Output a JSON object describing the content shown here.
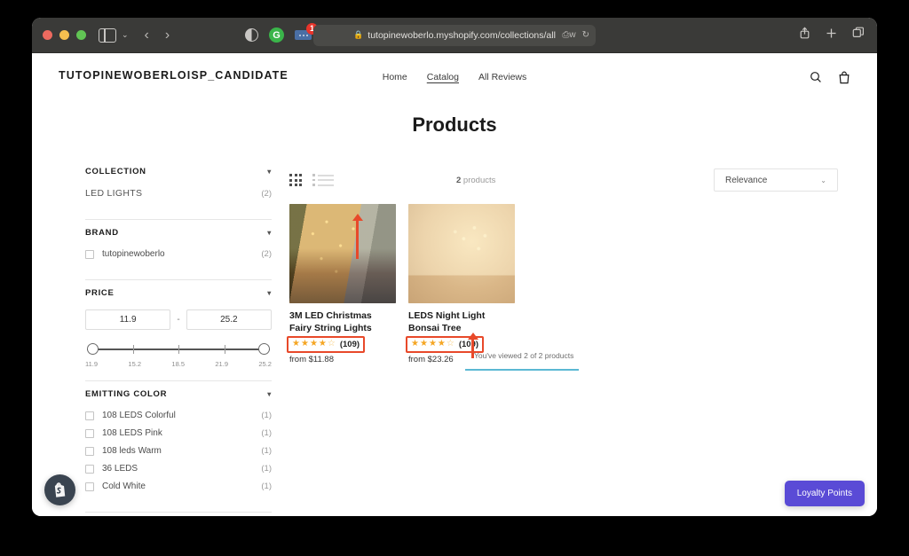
{
  "browser": {
    "url": "tutopinewoberlo.myshopify.com/collections/all",
    "lock_icon": "lock-icon",
    "back_icon": "‹",
    "forward_icon": "›",
    "sidebar_icon": "sidebar-toggle-icon",
    "chevron_icon": "⌄",
    "extension_badge_count": "1",
    "share_icon": "share-icon",
    "new_tab_icon": "+",
    "tabs_icon": "tabs-overview-icon",
    "reader_icon": "reader-icon",
    "reload_icon": "↻"
  },
  "site": {
    "brand": "TUTOPINEWOBERLOISP_CANDIDATE",
    "nav": [
      {
        "label": "Home",
        "active": false
      },
      {
        "label": "Catalog",
        "active": true
      },
      {
        "label": "All Reviews",
        "active": false
      }
    ],
    "search_icon": "search-icon",
    "cart_icon": "shopping-bag-icon",
    "page_title": "Products"
  },
  "filters": {
    "collection": {
      "heading": "COLLECTION",
      "caret": "▾",
      "items": [
        {
          "label": "LED LIGHTS",
          "count": "(2)"
        }
      ]
    },
    "brand": {
      "heading": "BRAND",
      "caret": "▾",
      "items": [
        {
          "label": "tutopinewoberlo",
          "count": "(2)",
          "checked": false
        }
      ]
    },
    "price": {
      "heading": "PRICE",
      "caret": "▾",
      "min_value": "11.9",
      "max_value": "25.2",
      "separator": "-",
      "ticks": [
        "11.9",
        "15.2",
        "18.5",
        "21.9",
        "25.2"
      ]
    },
    "emitting_color": {
      "heading": "EMITTING COLOR",
      "caret": "▾",
      "items": [
        {
          "label": "108 LEDS Colorful",
          "count": "(1)",
          "checked": false
        },
        {
          "label": "108 LEDS Pink",
          "count": "(1)",
          "checked": false
        },
        {
          "label": "108 leds Warm",
          "count": "(1)",
          "checked": false
        },
        {
          "label": "36 LEDS",
          "count": "(1)",
          "checked": false
        },
        {
          "label": "Cold White",
          "count": "(1)",
          "checked": false
        }
      ]
    }
  },
  "toolbar": {
    "grid_view_icon": "grid-view-icon",
    "list_view_icon": "list-view-icon",
    "count_number": "2",
    "count_label": " products",
    "sort_value": "Relevance",
    "sort_caret": "⌄"
  },
  "products": [
    {
      "title": "3M LED Christmas Fairy String Lights",
      "stars_full": 4,
      "stars_half": 1,
      "review_count": "(109)",
      "price": "from $11.88",
      "image_name": "string-lights-room-photo",
      "annotated": true
    },
    {
      "title": "LEDS Night Light Bonsai Tree",
      "stars_full": 4,
      "stars_half": 1,
      "review_count": "(109)",
      "price": "from $23.26",
      "image_name": "bonsai-tree-light-photo",
      "annotated": true
    }
  ],
  "footer": {
    "viewed_text": "You've viewed 2 of 2 products",
    "progress_color": "#5bb8d4"
  },
  "widgets": {
    "shopify_bubble_icon": "shopify-bag-icon",
    "loyalty_label": "Loyalty Points",
    "loyalty_color": "#5a4bd6"
  },
  "annotations": {
    "box_color": "#e8492a",
    "arrow_color": "#e8492a"
  }
}
